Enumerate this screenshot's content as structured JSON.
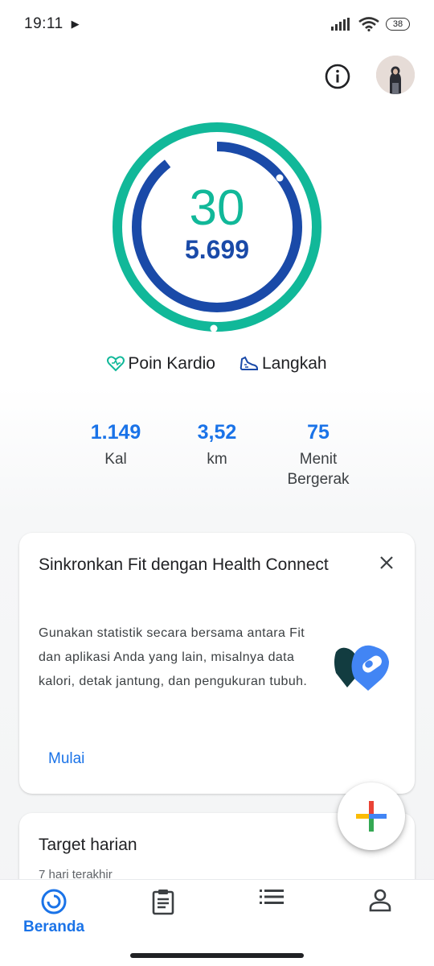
{
  "status_bar": {
    "time": "19:11",
    "battery": "38"
  },
  "ring": {
    "cardio_points": "30",
    "steps": "5.699",
    "cardio_color": "#11b899",
    "steps_color": "#1a4aa8"
  },
  "legend": {
    "cardio_label": "Poin Kardio",
    "steps_label": "Langkah"
  },
  "stats": [
    {
      "value": "1.149",
      "label": "Kal"
    },
    {
      "value": "3,52",
      "label": "km"
    },
    {
      "value": "75",
      "label": "Menit Bergerak"
    }
  ],
  "sync_card": {
    "title": "Sinkronkan Fit dengan Health Connect",
    "body": "Gunakan statistik secara bersama antara Fit dan aplikasi Anda yang lain, misalnya data kalori, detak jantung, dan pengukuran tubuh.",
    "action": "Mulai"
  },
  "target_card": {
    "title": "Target harian",
    "subtitle": "7 hari terakhir"
  },
  "bottom_nav": {
    "home_label": "Beranda"
  },
  "colors": {
    "accent": "#1a73e8"
  }
}
